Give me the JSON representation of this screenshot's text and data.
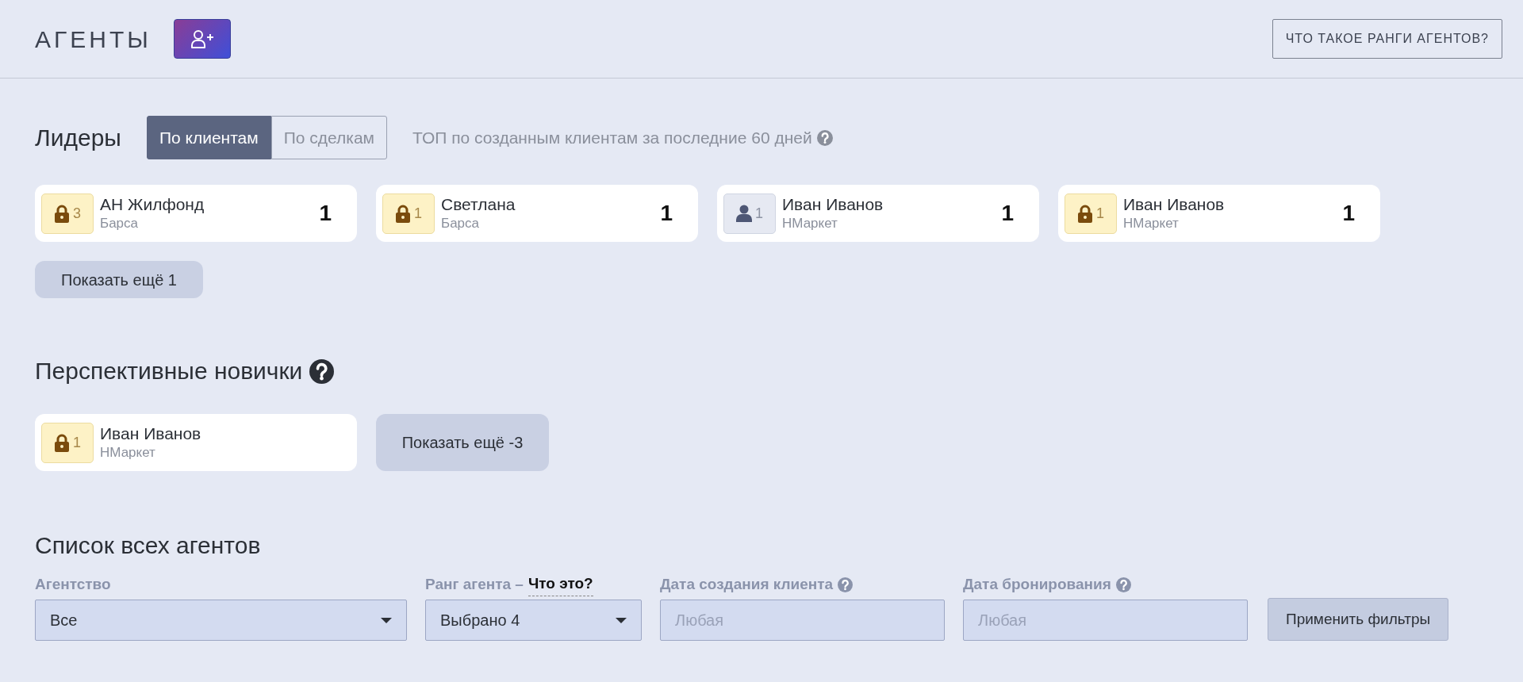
{
  "header": {
    "title": "АГЕНТЫ",
    "help_button": "ЧТО ТАКОЕ РАНГИ АГЕНТОВ?"
  },
  "leaders": {
    "title": "Лидеры",
    "tabs": [
      {
        "label": "По клиентам",
        "selected": true
      },
      {
        "label": "По сделкам",
        "selected": false
      }
    ],
    "info": "ТОП по созданным клиентам за последние 60 дней",
    "agents": [
      {
        "kind": "lock",
        "rank": "3",
        "name": "АН Жилфонд",
        "agency": "Барса",
        "count": "1"
      },
      {
        "kind": "lock",
        "rank": "1",
        "name": "Светлана",
        "agency": "Барса",
        "count": "1"
      },
      {
        "kind": "person",
        "rank": "1",
        "name": "Иван Иванов",
        "agency": "НМаркет",
        "count": "1"
      },
      {
        "kind": "lock",
        "rank": "1",
        "name": "Иван Иванов",
        "agency": "НМаркет",
        "count": "1"
      }
    ],
    "show_more": "Показать ещё 1"
  },
  "newcomers": {
    "title": "Перспективные новички",
    "agents": [
      {
        "kind": "lock",
        "rank": "1",
        "name": "Иван Иванов",
        "agency": "НМаркет"
      }
    ],
    "show_more": "Показать ещё -3"
  },
  "all_agents": {
    "title": "Список всех агентов",
    "filters": [
      {
        "kind": "select",
        "label": "Агентство",
        "value": "Все"
      },
      {
        "kind": "select",
        "label": "Ранг агента –",
        "link": "Что это?",
        "value": "Выбрано 4"
      },
      {
        "kind": "date",
        "label": "Дата создания клиента",
        "placeholder": "Любая"
      },
      {
        "kind": "date",
        "label": "Дата бронирования",
        "placeholder": "Любая"
      }
    ],
    "apply_button": "Применить фильтры"
  }
}
